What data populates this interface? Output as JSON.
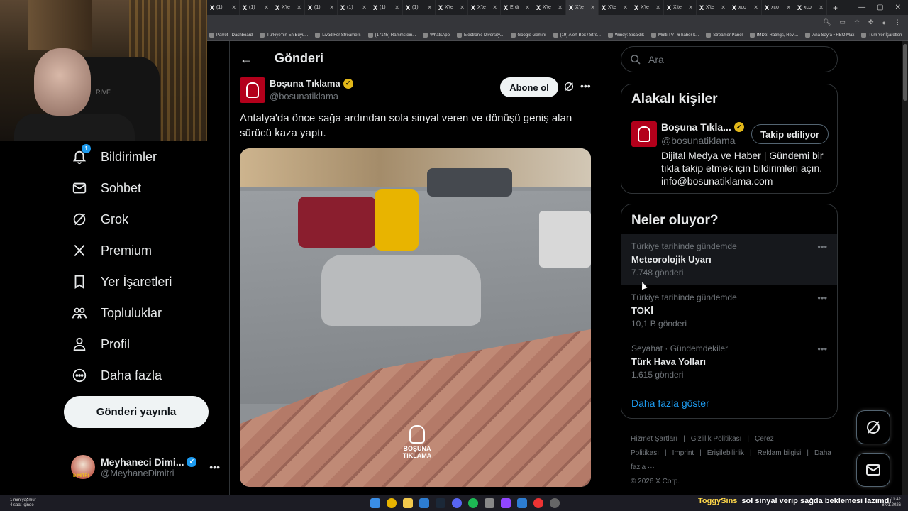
{
  "browser": {
    "tabs": [
      "(1)",
      "(1)",
      "X'te",
      "(1)",
      "(1)",
      "(1)",
      "(1)",
      "X'te",
      "X'te",
      "Erdi",
      "X'te",
      "X'te",
      "X'te",
      "X'te",
      "X'te",
      "X'te",
      "xco",
      "xco",
      "xco"
    ],
    "bookmarks": [
      "Parrot - Dashboard",
      "Türkiye'nin En Büyü...",
      "Livad For Streamers",
      "(17145) Rammstein...",
      "WhatsApp",
      "Electronic Diversity...",
      "Google Gemini",
      "(19) Alert Box / Stre...",
      "Windy: Sıcaklık",
      "Multi TV - 6 haber k...",
      "Streamer Panel",
      "IMDb: Ratings, Revi...",
      "Ana Sayfa • HBO Max",
      "Tüm Yer İşaretleri"
    ]
  },
  "webcam": {
    "chair_brand": "RIVE"
  },
  "nav": {
    "notifications_badge": "1",
    "items": [
      {
        "label": "Bildirimler",
        "icon": "bell-icon"
      },
      {
        "label": "Sohbet",
        "icon": "mail-icon"
      },
      {
        "label": "Grok",
        "icon": "grok-icon"
      },
      {
        "label": "Premium",
        "icon": "x-logo-icon"
      },
      {
        "label": "Yer İşaretleri",
        "icon": "bookmark-icon"
      },
      {
        "label": "Topluluklar",
        "icon": "communities-icon"
      },
      {
        "label": "Profil",
        "icon": "person-icon"
      },
      {
        "label": "Daha fazla",
        "icon": "more-circle-icon"
      }
    ],
    "post_button": "Gönderi yayınla",
    "account": {
      "name": "Meyhaneci Dimi...",
      "handle": "@MeyhaneDimitri",
      "avatar_text": "DIMITRI"
    }
  },
  "post": {
    "header_title": "Gönderi",
    "author_name": "Boşuna Tıklama",
    "author_handle": "@bosunatiklama",
    "subscribe_button": "Abone ol",
    "text": "Antalya'da önce sağa ardından sola sinyal veren ve dönüşü geniş alan sürücü kaza yaptı.",
    "media_watermark": "BOŞUNA TIKLAMA"
  },
  "search": {
    "placeholder": "Ara"
  },
  "related": {
    "title": "Alakalı kişiler",
    "name": "Boşuna Tıkla...",
    "handle": "@bosunatiklama",
    "follow_button": "Takip ediliyor",
    "bio": "Dijital Medya ve Haber | Gündemi bir tıkla takip etmek için bildirimleri açın. info@bosunatiklama.com"
  },
  "trends": {
    "title": "Neler oluyor?",
    "items": [
      {
        "category": "Türkiye tarihinde gündemde",
        "name": "Meteorolojik Uyarı",
        "count": "7.748 gönderi"
      },
      {
        "category": "Türkiye tarihinde gündemde",
        "name": "TOKİ",
        "count": "10,1 B gönderi"
      },
      {
        "category": "Seyahat · Gündemdekiler",
        "name": "Türk Hava Yolları",
        "count": "1.615 gönderi"
      }
    ],
    "show_more": "Daha fazla göster"
  },
  "footer": {
    "links": [
      "Hizmet Şartları",
      "|",
      "Gizlilik Politikası",
      "|",
      "Çerez Politikası",
      "|",
      "Imprint",
      "|",
      "Erişilebilirlik",
      "|",
      "Reklam bilgisi",
      "|",
      "Daha fazla ···"
    ],
    "copyright": "© 2026 X Corp."
  },
  "taskbar": {
    "weather_line1": "1 mm yağmur",
    "weather_line2": "4 saat içinde",
    "ticker_user": "ToggySins",
    "ticker_msg": "sol sinyal verip sağda beklemesi lazımdı",
    "time": "11:42",
    "date": "8.01.2026"
  },
  "colors": {
    "accent": "#1d9bf0",
    "verified": "#e2b719",
    "brand_red": "#b3001b"
  }
}
